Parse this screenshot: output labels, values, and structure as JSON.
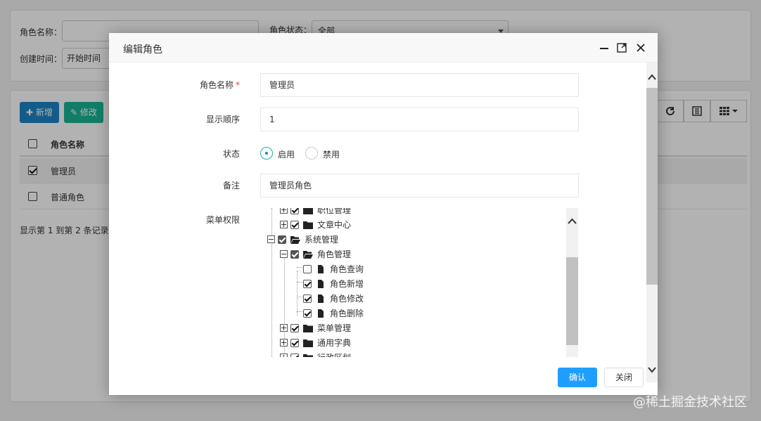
{
  "background": {
    "search": {
      "role_name_label": "角色名称：",
      "role_status_label": "角色状态：",
      "role_status_value": "全部",
      "create_time_label": "创建时间：",
      "start_time_placeholder": "开始时间"
    },
    "toolbar": {
      "add_label": "新增",
      "edit_label": "修改"
    },
    "table": {
      "header": "角色名称",
      "rows": [
        {
          "name": "管理员",
          "checked": true
        },
        {
          "name": "普通角色",
          "checked": false
        }
      ],
      "pagination": "显示第 1 到第 2 条记录"
    }
  },
  "modal": {
    "title": "编辑角色",
    "form": {
      "role_name_label": "角色名称",
      "role_name_value": "管理员",
      "sort_label": "显示顺序",
      "sort_value": "1",
      "status_label": "状态",
      "status_options": [
        "启用",
        "禁用"
      ],
      "status_selected": "启用",
      "remark_label": "备注",
      "remark_value": "管理员角色",
      "menu_label": "菜单权限"
    },
    "tree": [
      {
        "label": "职位管理",
        "level": 1,
        "type": "folder",
        "state": "checked",
        "toggle": "plus"
      },
      {
        "label": "文章中心",
        "level": 1,
        "type": "folder",
        "state": "checked",
        "toggle": "plus"
      },
      {
        "label": "系统管理",
        "level": 0,
        "type": "folder-open",
        "state": "partial",
        "toggle": "minus"
      },
      {
        "label": "角色管理",
        "level": 1,
        "type": "folder-open",
        "state": "partial",
        "toggle": "minus"
      },
      {
        "label": "角色查询",
        "level": 2,
        "type": "file",
        "state": "unchecked"
      },
      {
        "label": "角色新增",
        "level": 2,
        "type": "file",
        "state": "checked"
      },
      {
        "label": "角色修改",
        "level": 2,
        "type": "file",
        "state": "checked"
      },
      {
        "label": "角色删除",
        "level": 2,
        "type": "file",
        "state": "checked"
      },
      {
        "label": "菜单管理",
        "level": 1,
        "type": "folder",
        "state": "checked",
        "toggle": "plus"
      },
      {
        "label": "通用字典",
        "level": 1,
        "type": "folder",
        "state": "checked",
        "toggle": "plus"
      },
      {
        "label": "行政区划",
        "level": 1,
        "type": "folder",
        "state": "checked",
        "toggle": "plus"
      }
    ],
    "footer": {
      "ok_label": "确认",
      "close_label": "关闭"
    }
  },
  "watermark": "@稀土掘金技术社区",
  "colors": {
    "primary": "#1c84c6",
    "success": "#1ab394",
    "ok_button": "#1e9fff"
  }
}
